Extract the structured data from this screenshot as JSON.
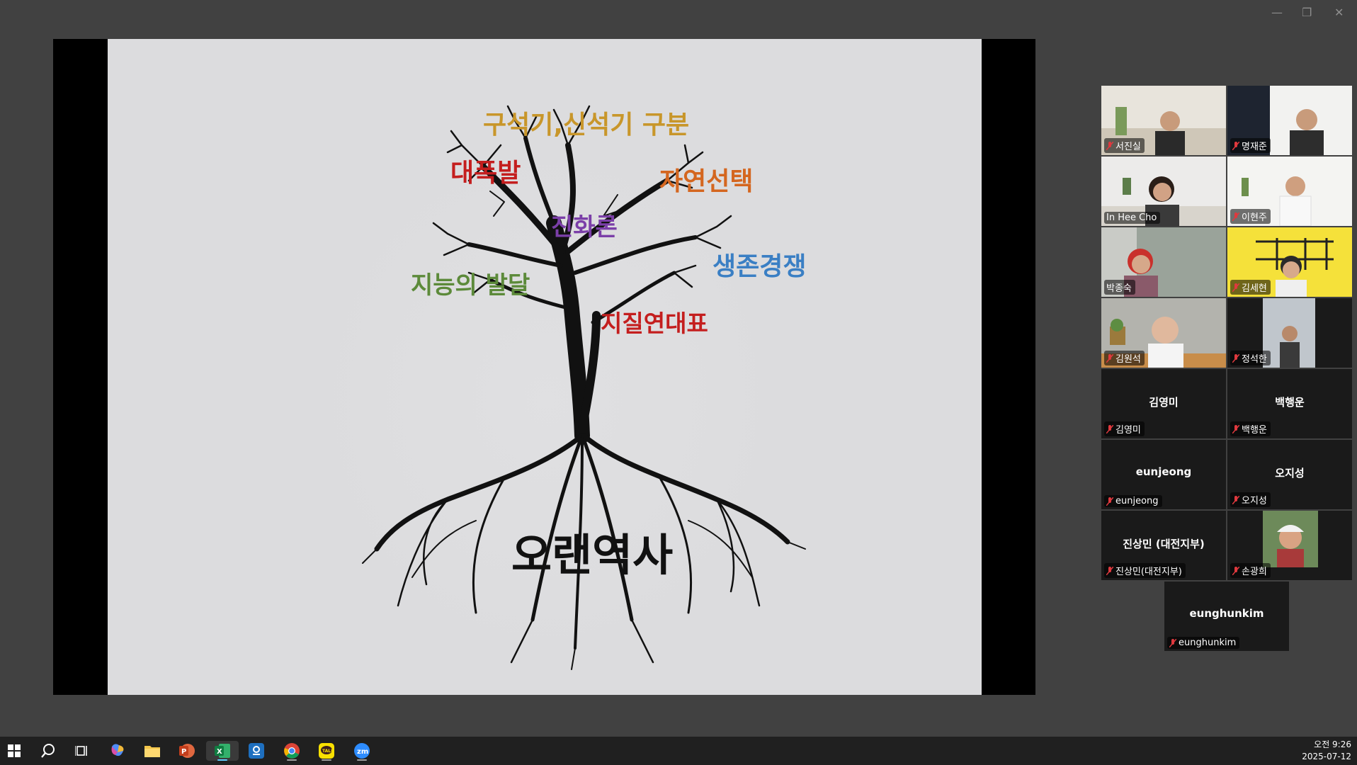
{
  "window_controls": {
    "minimize": "—",
    "restore": "❐",
    "close": "✕"
  },
  "slide": {
    "words": [
      {
        "text": "구석기,신석기 구분",
        "color": "#c8962a"
      },
      {
        "text": "대폭발",
        "color": "#c41e1e"
      },
      {
        "text": "자연선택",
        "color": "#d4661f"
      },
      {
        "text": "진화론",
        "color": "#7b3fa8"
      },
      {
        "text": "생존경쟁",
        "color": "#3a7fc4"
      },
      {
        "text": "지능의 발달",
        "color": "#5c8a3a"
      },
      {
        "text": "지질연대표",
        "color": "#c41e1e"
      },
      {
        "text": "오랜역사",
        "color": "#111111"
      }
    ]
  },
  "participants": [
    {
      "name": "서진실",
      "video": true,
      "muted": true
    },
    {
      "name": "명재준",
      "video": true,
      "muted": true
    },
    {
      "name": "In Hee Cho",
      "video": true,
      "muted": false,
      "active_speaker": true
    },
    {
      "name": "이현주",
      "video": true,
      "muted": true
    },
    {
      "name": "박종숙",
      "video": true,
      "muted": false
    },
    {
      "name": "김세현",
      "video": true,
      "muted": true
    },
    {
      "name": "김원석",
      "video": true,
      "muted": true
    },
    {
      "name": "정석한",
      "video": true,
      "muted": true
    },
    {
      "name": "김영미",
      "display": "김영미",
      "video": false,
      "muted": true
    },
    {
      "name": "백행운",
      "display": "백행운",
      "video": false,
      "muted": true
    },
    {
      "name": "eunjeong",
      "display": "eunjeong",
      "video": false,
      "muted": true
    },
    {
      "name": "오지성",
      "display": "오지성",
      "video": false,
      "muted": true
    },
    {
      "name": "진상민(대전지부)",
      "display": "진상민 (대전지부)",
      "video": false,
      "muted": true
    },
    {
      "name": "손광희",
      "video": true,
      "muted": true
    },
    {
      "name": "eunghunkim",
      "display": "eunghunkim",
      "video": false,
      "muted": true
    }
  ],
  "taskbar": {
    "apps": [
      "windows-start",
      "search",
      "task-view",
      "copilot",
      "file-explorer",
      "powerpoint",
      "excel",
      "hancom",
      "chrome",
      "kakaotalk",
      "zoom"
    ],
    "clock_time": "오전 9:26",
    "clock_date": "2025-07-12"
  },
  "colors": {
    "accent_active": "#23d27a",
    "mute_red": "#e0393e"
  }
}
